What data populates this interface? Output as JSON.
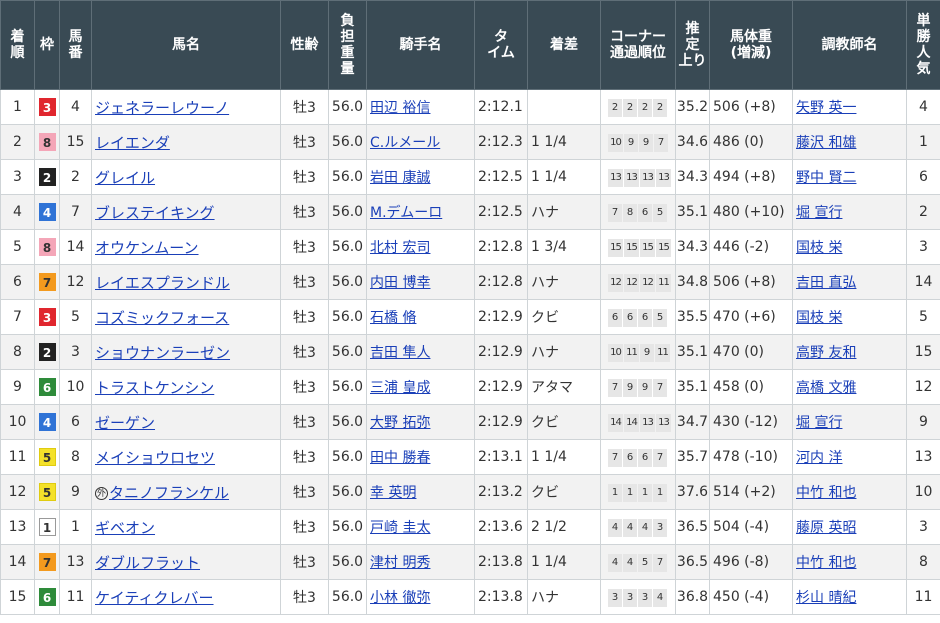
{
  "headers": [
    "着順",
    "枠",
    "馬番",
    "馬名",
    "性齢",
    "負担重量",
    "騎手名",
    "タイム",
    "着差",
    "コーナー通過順位",
    "推定上り",
    "馬体重(増減)",
    "調教師名",
    "単勝人気"
  ],
  "header_lines": {
    "chakujun": [
      "着",
      "順"
    ],
    "waku": [
      "枠"
    ],
    "umaban": [
      "馬",
      "番"
    ],
    "bamei": [
      "馬名"
    ],
    "seirei": [
      "性齢"
    ],
    "futan": [
      "負",
      "担",
      "重",
      "量"
    ],
    "kishu": [
      "騎手名"
    ],
    "time": [
      "タ",
      "イム"
    ],
    "chakusa": [
      "着差"
    ],
    "corner": [
      "コーナー",
      "通過順位"
    ],
    "agari": [
      "推",
      "定",
      "上り"
    ],
    "bataiju": [
      "馬体重",
      "(増減)"
    ],
    "chokyoshi": [
      "調教師名"
    ],
    "ninki": [
      "単",
      "勝",
      "人",
      "気"
    ]
  },
  "waku_colors": {
    "1": {
      "bg": "#ffffff",
      "fg": "#333333",
      "border": "#999999"
    },
    "2": {
      "bg": "#222222",
      "fg": "#ffffff",
      "border": "#222222"
    },
    "3": {
      "bg": "#e0262e",
      "fg": "#ffffff",
      "border": "#e0262e"
    },
    "4": {
      "bg": "#2f73d6",
      "fg": "#ffffff",
      "border": "#2f73d6"
    },
    "5": {
      "bg": "#f4e12a",
      "fg": "#333333",
      "border": "#e0cc10"
    },
    "6": {
      "bg": "#2e8b3a",
      "fg": "#ffffff",
      "border": "#2e8b3a"
    },
    "7": {
      "bg": "#f39a1e",
      "fg": "#333333",
      "border": "#f39a1e"
    },
    "8": {
      "bg": "#f4a6b8",
      "fg": "#333333",
      "border": "#f4a6b8"
    }
  },
  "rows": [
    {
      "pos": "1",
      "waku": "3",
      "num": "4",
      "horse": "ジェネラーレウーノ",
      "mark": "",
      "sex_age": "牡3",
      "weight": "56.0",
      "jockey": "田辺 裕信",
      "time": "2:12.1",
      "margin": "",
      "corner": [
        "2",
        "2",
        "2",
        "2"
      ],
      "agari": "35.2",
      "body": "506 (+8)",
      "trainer": "矢野 英一",
      "pop": "4"
    },
    {
      "pos": "2",
      "waku": "8",
      "num": "15",
      "horse": "レイエンダ",
      "mark": "",
      "sex_age": "牡3",
      "weight": "56.0",
      "jockey": "C.ルメール",
      "time": "2:12.3",
      "margin": "1 1/4",
      "corner": [
        "10",
        "9",
        "9",
        "7"
      ],
      "agari": "34.6",
      "body": "486 (0)",
      "trainer": "藤沢 和雄",
      "pop": "1"
    },
    {
      "pos": "3",
      "waku": "2",
      "num": "2",
      "horse": "グレイル",
      "mark": "",
      "sex_age": "牡3",
      "weight": "56.0",
      "jockey": "岩田 康誠",
      "time": "2:12.5",
      "margin": "1 1/4",
      "corner": [
        "13",
        "13",
        "13",
        "13"
      ],
      "agari": "34.3",
      "body": "494 (+8)",
      "trainer": "野中 賢二",
      "pop": "6"
    },
    {
      "pos": "4",
      "waku": "4",
      "num": "7",
      "horse": "ブレステイキング",
      "mark": "",
      "sex_age": "牡3",
      "weight": "56.0",
      "jockey": "M.デムーロ",
      "time": "2:12.5",
      "margin": "ハナ",
      "corner": [
        "7",
        "8",
        "6",
        "5"
      ],
      "agari": "35.1",
      "body": "480 (+10)",
      "trainer": "堀 宣行",
      "pop": "2"
    },
    {
      "pos": "5",
      "waku": "8",
      "num": "14",
      "horse": "オウケンムーン",
      "mark": "",
      "sex_age": "牡3",
      "weight": "56.0",
      "jockey": "北村 宏司",
      "time": "2:12.8",
      "margin": "1 3/4",
      "corner": [
        "15",
        "15",
        "15",
        "15"
      ],
      "agari": "34.3",
      "body": "446 (-2)",
      "trainer": "国枝 栄",
      "pop": "3"
    },
    {
      "pos": "6",
      "waku": "7",
      "num": "12",
      "horse": "レイエスプランドル",
      "mark": "",
      "sex_age": "牡3",
      "weight": "56.0",
      "jockey": "内田 博幸",
      "time": "2:12.8",
      "margin": "ハナ",
      "corner": [
        "12",
        "12",
        "12",
        "11"
      ],
      "agari": "34.8",
      "body": "506 (+8)",
      "trainer": "吉田 直弘",
      "pop": "14"
    },
    {
      "pos": "7",
      "waku": "3",
      "num": "5",
      "horse": "コズミックフォース",
      "mark": "",
      "sex_age": "牡3",
      "weight": "56.0",
      "jockey": "石橋 脩",
      "time": "2:12.9",
      "margin": "クビ",
      "corner": [
        "6",
        "6",
        "6",
        "5"
      ],
      "agari": "35.5",
      "body": "470 (+6)",
      "trainer": "国枝 栄",
      "pop": "5"
    },
    {
      "pos": "8",
      "waku": "2",
      "num": "3",
      "horse": "ショウナンラーゼン",
      "mark": "",
      "sex_age": "牡3",
      "weight": "56.0",
      "jockey": "吉田 隼人",
      "time": "2:12.9",
      "margin": "ハナ",
      "corner": [
        "10",
        "11",
        "9",
        "11"
      ],
      "agari": "35.1",
      "body": "470 (0)",
      "trainer": "高野 友和",
      "pop": "15"
    },
    {
      "pos": "9",
      "waku": "6",
      "num": "10",
      "horse": "トラストケンシン",
      "mark": "",
      "sex_age": "牡3",
      "weight": "56.0",
      "jockey": "三浦 皇成",
      "time": "2:12.9",
      "margin": "アタマ",
      "corner": [
        "7",
        "9",
        "9",
        "7"
      ],
      "agari": "35.1",
      "body": "458 (0)",
      "trainer": "高橋 文雅",
      "pop": "12"
    },
    {
      "pos": "10",
      "waku": "4",
      "num": "6",
      "horse": "ゼーゲン",
      "mark": "",
      "sex_age": "牡3",
      "weight": "56.0",
      "jockey": "大野 拓弥",
      "time": "2:12.9",
      "margin": "クビ",
      "corner": [
        "14",
        "14",
        "13",
        "13"
      ],
      "agari": "34.7",
      "body": "430 (-12)",
      "trainer": "堀 宣行",
      "pop": "9"
    },
    {
      "pos": "11",
      "waku": "5",
      "num": "8",
      "horse": "メイショウロセツ",
      "mark": "",
      "sex_age": "牡3",
      "weight": "56.0",
      "jockey": "田中 勝春",
      "time": "2:13.1",
      "margin": "1 1/4",
      "corner": [
        "7",
        "6",
        "6",
        "7"
      ],
      "agari": "35.7",
      "body": "478 (-10)",
      "trainer": "河内 洋",
      "pop": "13"
    },
    {
      "pos": "12",
      "waku": "5",
      "num": "9",
      "horse": "タニノフランケル",
      "mark": "外",
      "sex_age": "牡3",
      "weight": "56.0",
      "jockey": "幸 英明",
      "time": "2:13.2",
      "margin": "クビ",
      "corner": [
        "1",
        "1",
        "1",
        "1"
      ],
      "agari": "37.6",
      "body": "514 (+2)",
      "trainer": "中竹 和也",
      "pop": "10"
    },
    {
      "pos": "13",
      "waku": "1",
      "num": "1",
      "horse": "ギベオン",
      "mark": "",
      "sex_age": "牡3",
      "weight": "56.0",
      "jockey": "戸崎 圭太",
      "time": "2:13.6",
      "margin": "2 1/2",
      "corner": [
        "4",
        "4",
        "4",
        "3"
      ],
      "agari": "36.5",
      "body": "504 (-4)",
      "trainer": "藤原 英昭",
      "pop": "3"
    },
    {
      "pos": "14",
      "waku": "7",
      "num": "13",
      "horse": "ダブルフラット",
      "mark": "",
      "sex_age": "牡3",
      "weight": "56.0",
      "jockey": "津村 明秀",
      "time": "2:13.8",
      "margin": "1 1/4",
      "corner": [
        "4",
        "4",
        "5",
        "7"
      ],
      "agari": "36.5",
      "body": "496 (-8)",
      "trainer": "中竹 和也",
      "pop": "8"
    },
    {
      "pos": "15",
      "waku": "6",
      "num": "11",
      "horse": "ケイティクレバー",
      "mark": "",
      "sex_age": "牡3",
      "weight": "56.0",
      "jockey": "小林 徹弥",
      "time": "2:13.8",
      "margin": "ハナ",
      "corner": [
        "3",
        "3",
        "3",
        "4"
      ],
      "agari": "36.8",
      "body": "450 (-4)",
      "trainer": "杉山 晴紀",
      "pop": "11"
    }
  ]
}
